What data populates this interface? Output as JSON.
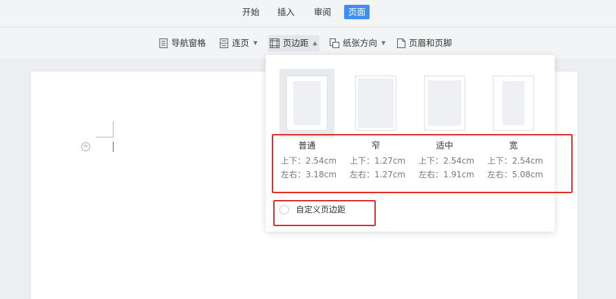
{
  "tabs": [
    {
      "label": "开始"
    },
    {
      "label": "插入"
    },
    {
      "label": "审阅"
    },
    {
      "label": "页面"
    }
  ],
  "toolbar": {
    "nav_pane": "导航窗格",
    "continuous": "连页",
    "margins": "页边距",
    "orientation": "纸张方向",
    "header_footer": "页眉和页脚"
  },
  "margins_menu": {
    "options": [
      {
        "name": "普通",
        "tb": "上下：2.54cm",
        "lr": "左右：3.18cm",
        "selected": true
      },
      {
        "name": "窄",
        "tb": "上下：1.27cm",
        "lr": "左右：1.27cm",
        "selected": false
      },
      {
        "name": "适中",
        "tb": "上下：2.54cm",
        "lr": "左右：1.91cm",
        "selected": false
      },
      {
        "name": "宽",
        "tb": "上下：2.54cm",
        "lr": "左右：5.08cm",
        "selected": false
      }
    ],
    "custom_label": "自定义页边距"
  },
  "colors": {
    "accent": "#3d8ff2",
    "highlight": "#e02b2b"
  }
}
